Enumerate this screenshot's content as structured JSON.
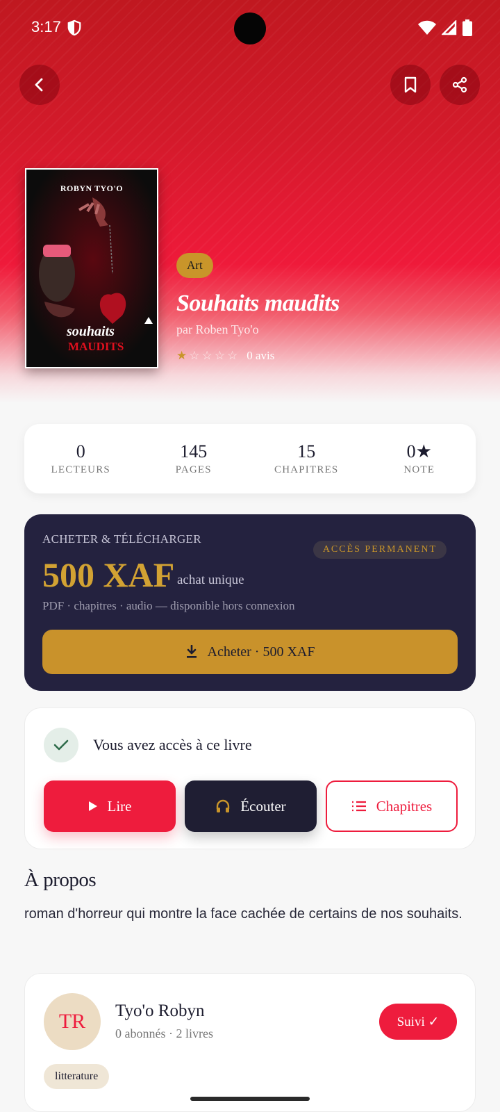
{
  "status_bar": {
    "time": "3:17"
  },
  "header": {
    "back": "back-icon",
    "bookmark": "bookmark-icon",
    "share": "share-icon"
  },
  "book": {
    "cover": {
      "author_text": "ROBYN TYO'O",
      "title_line1": "souhaits",
      "title_line2": "MAUDITS"
    },
    "category": "Art",
    "title": "Souhaits maudits",
    "author_line": "par Roben Tyo'o",
    "rating_value": 0.5,
    "rating_max": 5,
    "reviews": "0 avis"
  },
  "stats": [
    {
      "value": "0",
      "label": "LECTEURS"
    },
    {
      "value": "145",
      "label": "PAGES"
    },
    {
      "value": "15",
      "label": "CHAPITRES"
    },
    {
      "value": "0★",
      "label": "NOTE"
    }
  ],
  "purchase": {
    "kicker": "ACHETER & TÉLÉCHARGER",
    "badge": "ACCÈS PERMANENT",
    "price": "500 XAF",
    "price_note": "achat unique",
    "description": "PDF · chapitres · audio — disponible hors connexion",
    "button_label": "Acheter · 500 XAF"
  },
  "access": {
    "message": "Vous avez accès à ce livre",
    "read_label": "Lire",
    "listen_label": "Écouter",
    "chapters_label": "Chapitres"
  },
  "about": {
    "heading": "À propos",
    "text": "roman d'horreur qui montre la face cachée de certains de nos souhaits."
  },
  "author": {
    "initials": "TR",
    "name": "Tyo'o Robyn",
    "meta": "0 abonnés · 2 livres",
    "follow_label": "Suivi ✓",
    "genre": "litterature"
  },
  "colors": {
    "accent": "#ee1c3d",
    "gold": "#c9952a",
    "navy": "#24223f"
  }
}
